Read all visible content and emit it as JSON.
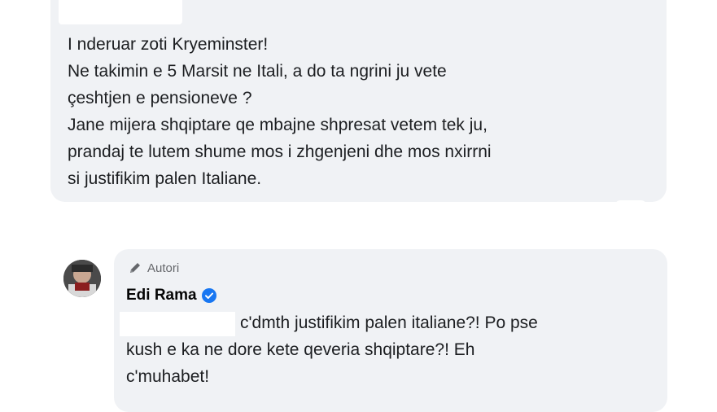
{
  "top_comment": {
    "lines": [
      "I nderuar zoti Kryeminster!",
      "Ne takimin e 5 Marsit ne Itali, a do ta ngrini ju vete",
      "çeshtjen e pensioneve ?",
      "Jane mijera shqiptare qe mbajne shpresat vetem tek ju,",
      "prandaj te lutem shume mos i zhgenjeni dhe mos nxirrni",
      "si justifikim palen Italiane."
    ]
  },
  "reply": {
    "badge_label": "Autori",
    "badge_icon": "pencil-icon",
    "author_name": "Edi Rama",
    "verified_icon": "verified-badge-icon",
    "accent_color": "#1877f2",
    "lines": [
      "c'dmth justifikim palen italiane?! Po pse",
      "kush e ka ne dore kete qeveria shqiptare?! Eh",
      "c'muhabet!"
    ]
  }
}
